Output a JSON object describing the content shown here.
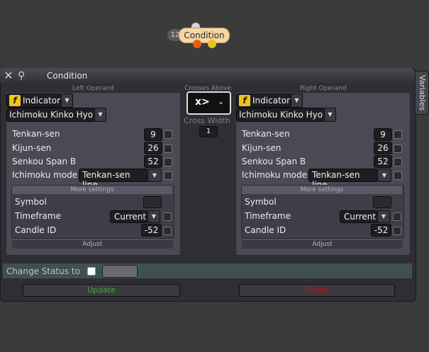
{
  "node": {
    "id": "12",
    "label": "Condition"
  },
  "dialog": {
    "title": "Condition",
    "variables_tab": "Variables",
    "left_label": "Left Operand",
    "right_label": "Right Operand",
    "crosses_label": "Crosses Above",
    "operator": "x>",
    "cross_width_label": "Cross Width",
    "cross_width_value": "1"
  },
  "left": {
    "type": "Indicator",
    "indicator": "Ichimoku Kinko Hyo",
    "params": [
      {
        "label": "Tenkan-sen",
        "value": "9"
      },
      {
        "label": "Kijun-sen",
        "value": "26"
      },
      {
        "label": "Senkou Span B",
        "value": "52"
      }
    ],
    "mode_label": "Ichimoku mode",
    "mode_value": "Tenkan-sen line",
    "more_settings": "More settings",
    "symbol_label": "Symbol",
    "symbol_value": "",
    "timeframe_label": "Timeframe",
    "timeframe_value": "Current",
    "candle_label": "Candle ID",
    "candle_value": "-52",
    "adjust": "Adjust"
  },
  "right": {
    "type": "Indicator",
    "indicator": "Ichimoku Kinko Hyo",
    "params": [
      {
        "label": "Tenkan-sen",
        "value": "9"
      },
      {
        "label": "Kijun-sen",
        "value": "26"
      },
      {
        "label": "Senkou Span B",
        "value": "52"
      }
    ],
    "mode_label": "Ichimoku mode",
    "mode_value": "Tenkan-sen line",
    "more_settings": "More settings",
    "symbol_label": "Symbol",
    "symbol_value": "",
    "timeframe_label": "Timeframe",
    "timeframe_value": "Current",
    "candle_label": "Candle ID",
    "candle_value": "-52",
    "adjust": "Adjust"
  },
  "status": {
    "label": "Change Status to"
  },
  "buttons": {
    "update": "Update",
    "delete": "Delete"
  },
  "colors": {
    "update": "#3fae2a",
    "delete": "#c0161a",
    "node": "#f6d7a4",
    "status_bar": "#3e514f"
  }
}
